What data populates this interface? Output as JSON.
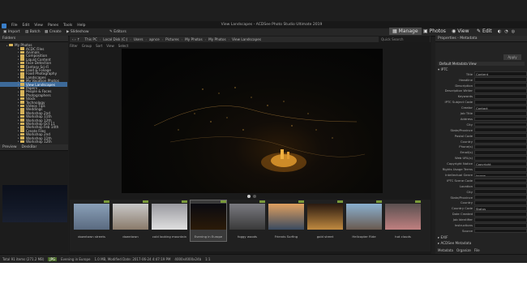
{
  "window": {
    "title": "View Landscapes - ACDSee Photo Studio Ultimate 2019"
  },
  "menu": [
    "File",
    "Edit",
    "View",
    "Panes",
    "Tools",
    "Help"
  ],
  "toolbar": {
    "import": "Import",
    "batch": "Batch",
    "create": "Create",
    "slideshow": "Slideshow",
    "editors": "Editors"
  },
  "modes": {
    "manage": "Manage",
    "photos": "Photos",
    "view": "View",
    "edit": "Edit"
  },
  "folders": {
    "title": "Folders",
    "items": [
      "My Photos",
      "ACDC Files",
      "Animals",
      "Composition",
      "Liquid Content",
      "Face Detection",
      "Fantasy Sci-Fi",
      "Food & Foliage",
      "Food Photography",
      "Landscapes",
      "My Vacation Photos",
      "View Landscapes",
      "Papers",
      "People & Faces",
      "Photographers",
      "Stock",
      "Technology",
      "Videos Tips",
      "Weddings",
      "Workshop 2nd",
      "Workshop 11th",
      "Workshop 12th",
      "Workshop Oct 11",
      "Workshop Feb 14th",
      "Create Files",
      "Workshop 2nd",
      "Workshop 11th",
      "Workshop 12th"
    ],
    "selected": 11
  },
  "preview": {
    "tab1": "Preview",
    "tab2": "DeskBar"
  },
  "address": {
    "crumbs": [
      "This PC",
      "Local Disk (C:)",
      "Users",
      "apnce",
      "Pictures",
      "My Photos",
      "My Photos",
      "View Landscapes"
    ],
    "search_placeholder": "Quick Search"
  },
  "filters": [
    "Filter",
    "Group",
    "Sort",
    "View",
    "Select"
  ],
  "thumbnails": [
    {
      "label": "downtown streets",
      "selected": false
    },
    {
      "label": "downtown",
      "selected": false
    },
    {
      "label": "cold looking mountain",
      "selected": false
    },
    {
      "label": "Evening in Europe",
      "selected": true
    },
    {
      "label": "foggy woods",
      "selected": false
    },
    {
      "label": "Friends Surfing",
      "selected": false
    },
    {
      "label": "gold street",
      "selected": false
    },
    {
      "label": "Helicopter Ride",
      "selected": false
    },
    {
      "label": "hot clouds",
      "selected": false
    }
  ],
  "properties": {
    "title": "Properties - Metadata",
    "apply": "Apply",
    "view": "Default Metadata View",
    "sections": {
      "iptc": "IPTC",
      "exif": "EXIF",
      "acdsee": "ACDSee Metadata"
    },
    "fields": [
      "Title",
      "Headline",
      "Description",
      "Description Writer",
      "Keywords",
      "IPTC Subject Code",
      "Creator",
      "Job Title",
      "Address",
      "City",
      "State/Province",
      "Postal Code",
      "Country",
      "Phone(s)",
      "Email(s)",
      "Web URL(s)",
      "Copyright Notice",
      "Rights Usage Terms",
      "Intellectual Genre",
      "IPTC Scene Code",
      "Location",
      "City",
      "State/Province",
      "Country",
      "Country Code",
      "Date Created",
      "Job Identifier",
      "Instructions",
      "Source"
    ],
    "values": {
      "0": "Content",
      "6": "Contact",
      "16": "Copyright",
      "18": "Image",
      "24": "Status"
    },
    "tabs": [
      "Metadata",
      "Organize",
      "File"
    ]
  },
  "status": {
    "total": "Total 91 items (271.2 MB)",
    "format": "JPG",
    "name": "Evening in Europe",
    "size": "1.0 MB, Modified Date: 2017-06-24 4:47:19 PM",
    "dims": "4000x4000x24b",
    "zoom": "1:1"
  }
}
